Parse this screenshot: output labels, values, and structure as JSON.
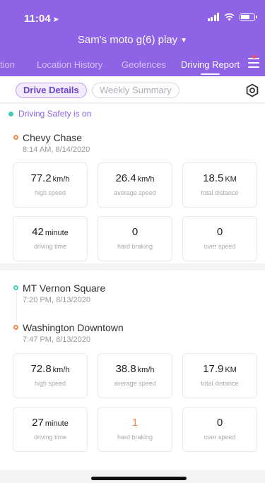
{
  "status_bar": {
    "time": "11:04"
  },
  "header": {
    "device_label": "Sam's moto g(6) play",
    "tabs": [
      "tion",
      "Location History",
      "Geofences",
      "Driving Report"
    ],
    "active_tab": "Driving Report"
  },
  "subtabs": {
    "items": [
      "Drive Details",
      "Weekly Summary"
    ],
    "active": "Drive Details"
  },
  "safety_status": "Driving Safety is on",
  "trips": [
    {
      "stops": [
        {
          "name": "Chevy Chase",
          "time": "8:14 AM, 8/14/2020"
        }
      ],
      "stats": [
        {
          "value": "77.2",
          "unit": "km/h",
          "label": "high speed"
        },
        {
          "value": "26.4",
          "unit": "km/h",
          "label": "average speed"
        },
        {
          "value": "18.5",
          "unit": "KM",
          "label": "total distance"
        },
        {
          "value": "42",
          "unit": "minute",
          "label": "driving time"
        },
        {
          "value": "0",
          "unit": "",
          "label": "hard braking"
        },
        {
          "value": "0",
          "unit": "",
          "label": "over speed"
        }
      ]
    },
    {
      "stops": [
        {
          "name": "MT Vernon Square",
          "time": "7:20 PM, 8/13/2020"
        },
        {
          "name": "Washington Downtown",
          "time": "7:47 PM, 8/13/2020"
        }
      ],
      "stats": [
        {
          "value": "72.8",
          "unit": "km/h",
          "label": "high speed"
        },
        {
          "value": "38.8",
          "unit": "km/h",
          "label": "average speed"
        },
        {
          "value": "17.9",
          "unit": "KM",
          "label": "total distance"
        },
        {
          "value": "27",
          "unit": "minute",
          "label": "driving time"
        },
        {
          "value": "1",
          "unit": "",
          "label": "hard braking"
        },
        {
          "value": "0",
          "unit": "",
          "label": "over speed"
        }
      ]
    }
  ],
  "colors": {
    "primary": "#8e63e6",
    "accent_teal": "#3fcfb5",
    "accent_orange": "#f08a4b",
    "alert_dot": "#ff4d4f"
  }
}
